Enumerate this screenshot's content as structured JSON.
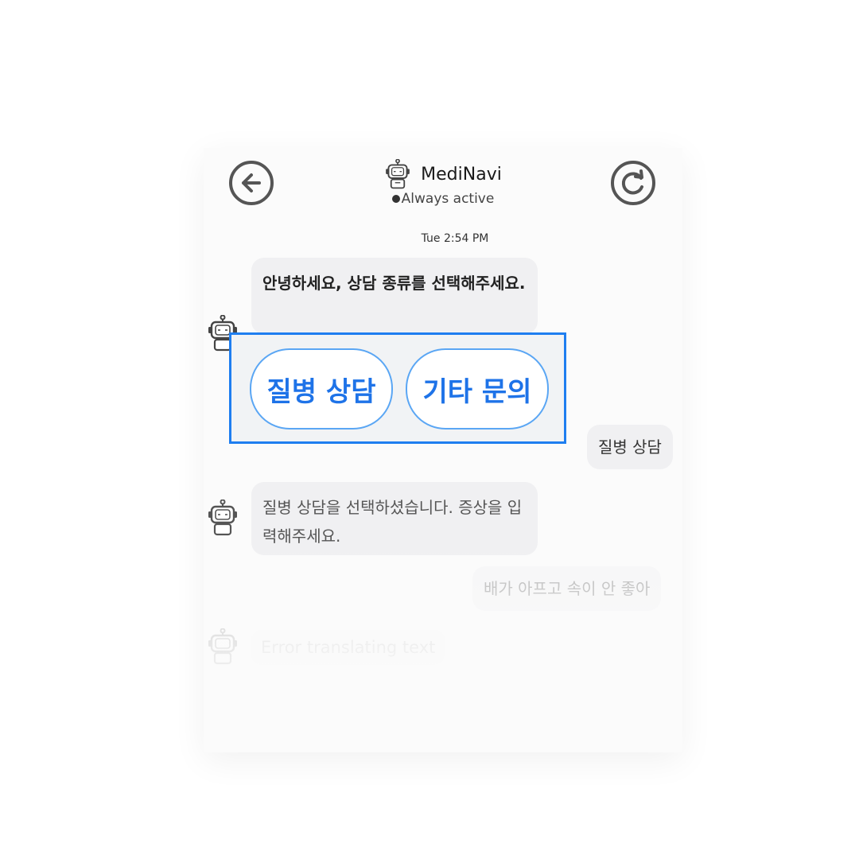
{
  "header": {
    "back_icon": "arrow-left-circle-icon",
    "refresh_icon": "refresh-circle-icon",
    "bot_icon": "robot-icon",
    "title": "MediNavi",
    "status": "Always active"
  },
  "chat": {
    "timestamp": "Tue 2:54 PM",
    "messages": [
      {
        "from": "bot",
        "text": "안녕하세요, 상담 종류를 선택해주세요."
      },
      {
        "from": "user",
        "text": "질병 상담"
      },
      {
        "from": "bot",
        "text": "질병 상담을 선택하셨습니다. 증상을 입력해주세요."
      },
      {
        "from": "user",
        "text": "배가 아프고 속이 안 좋아"
      },
      {
        "from": "bot",
        "text": "Error translating text"
      }
    ]
  },
  "quick_replies": {
    "options": [
      "질병 상담",
      "기타 문의"
    ],
    "accent": "#1e7ef0"
  }
}
